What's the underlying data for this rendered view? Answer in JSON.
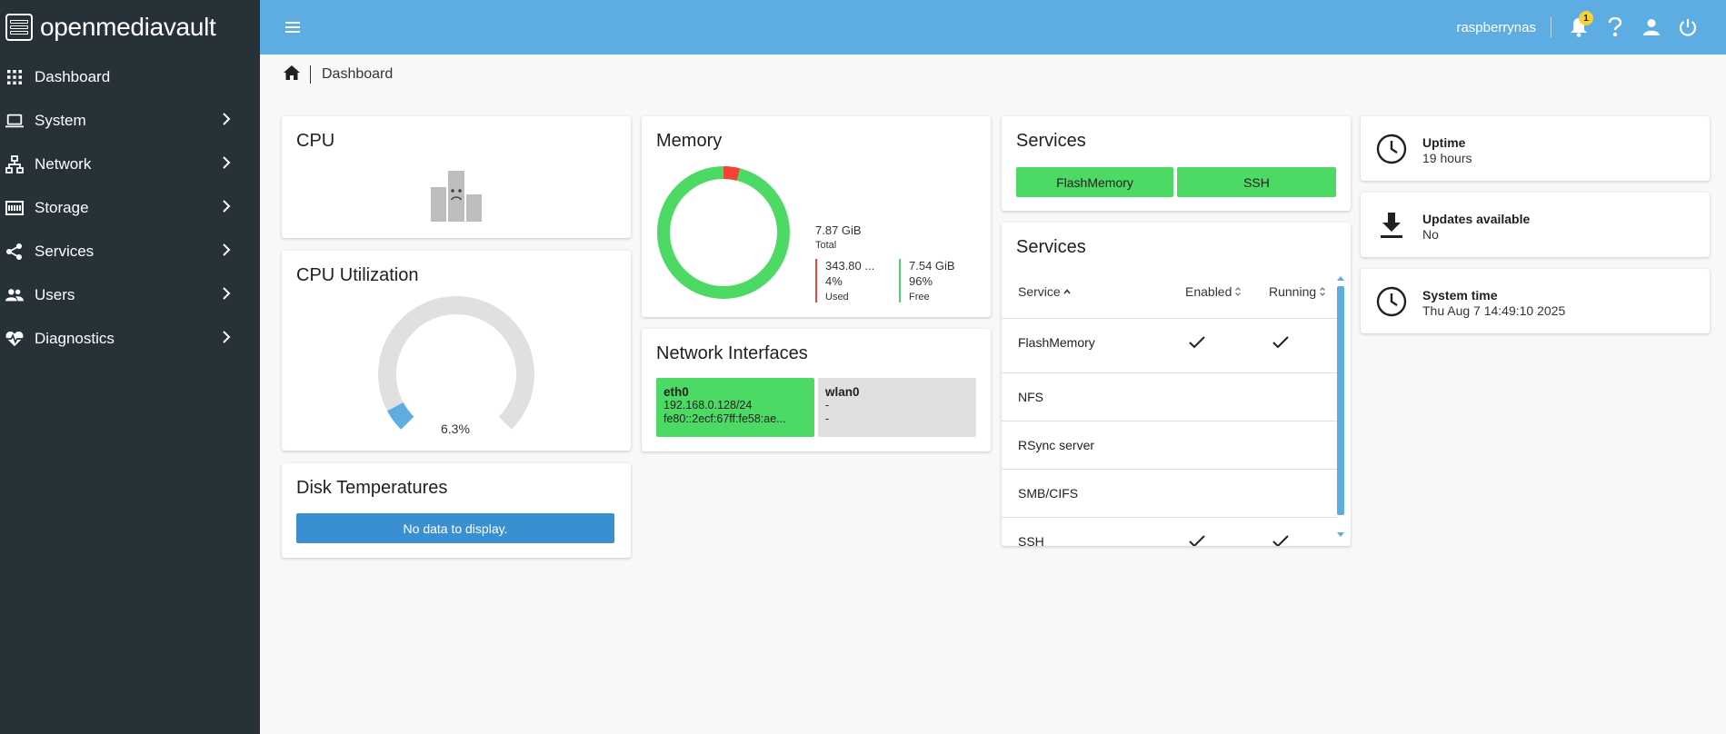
{
  "brand": {
    "name": "openmediavault"
  },
  "sidebar": {
    "items": [
      {
        "label": "Dashboard",
        "icon": "grid-icon",
        "has_children": false
      },
      {
        "label": "System",
        "icon": "laptop-icon",
        "has_children": true
      },
      {
        "label": "Network",
        "icon": "network-icon",
        "has_children": true
      },
      {
        "label": "Storage",
        "icon": "storage-icon",
        "has_children": true
      },
      {
        "label": "Services",
        "icon": "share-icon",
        "has_children": true
      },
      {
        "label": "Users",
        "icon": "users-icon",
        "has_children": true
      },
      {
        "label": "Diagnostics",
        "icon": "heartbeat-icon",
        "has_children": true
      }
    ]
  },
  "topbar": {
    "hostname": "raspberrynas",
    "notification_count": "1",
    "color": "#5dade2"
  },
  "breadcrumb": {
    "current": "Dashboard"
  },
  "cpu": {
    "title": "CPU"
  },
  "cpu_util": {
    "title": "CPU Utilization",
    "value_label": "6.3%",
    "value_fraction": 0.063
  },
  "disk_temps": {
    "title": "Disk Temperatures",
    "empty_text": "No data to display."
  },
  "memory": {
    "title": "Memory",
    "total_value": "7.87 GiB",
    "total_label": "Total",
    "used_value": "343.80 ...",
    "used_percent": "4%",
    "used_label": "Used",
    "free_value": "7.54 GiB",
    "free_percent": "96%",
    "free_label": "Free",
    "used_fraction": 0.04,
    "used_color": "#f44336",
    "free_color": "#4cd964"
  },
  "network": {
    "title": "Network Interfaces",
    "interfaces": [
      {
        "name": "eth0",
        "line1": "192.168.0.128/24",
        "line2": "fe80::2ecf:67ff:fe58:ae...",
        "color": "#4cd964"
      },
      {
        "name": "wlan0",
        "line1": "-",
        "line2": "-",
        "color": "#e0e0e0"
      }
    ]
  },
  "services_status": {
    "title": "Services",
    "buttons": [
      "FlashMemory",
      "SSH"
    ]
  },
  "services_table": {
    "title": "Services",
    "headers": {
      "service": "Service",
      "enabled": "Enabled",
      "running": "Running"
    },
    "rows": [
      {
        "name": "FlashMemory",
        "enabled": true,
        "running": true
      },
      {
        "name": "NFS",
        "enabled": false,
        "running": false
      },
      {
        "name": "RSync server",
        "enabled": false,
        "running": false
      },
      {
        "name": "SMB/CIFS",
        "enabled": false,
        "running": false
      },
      {
        "name": "SSH",
        "enabled": true,
        "running": true
      }
    ]
  },
  "uptime": {
    "title": "Uptime",
    "value": "19 hours"
  },
  "updates": {
    "title": "Updates available",
    "value": "No"
  },
  "system_time": {
    "title": "System time",
    "value": "Thu Aug 7 14:49:10 2025"
  }
}
